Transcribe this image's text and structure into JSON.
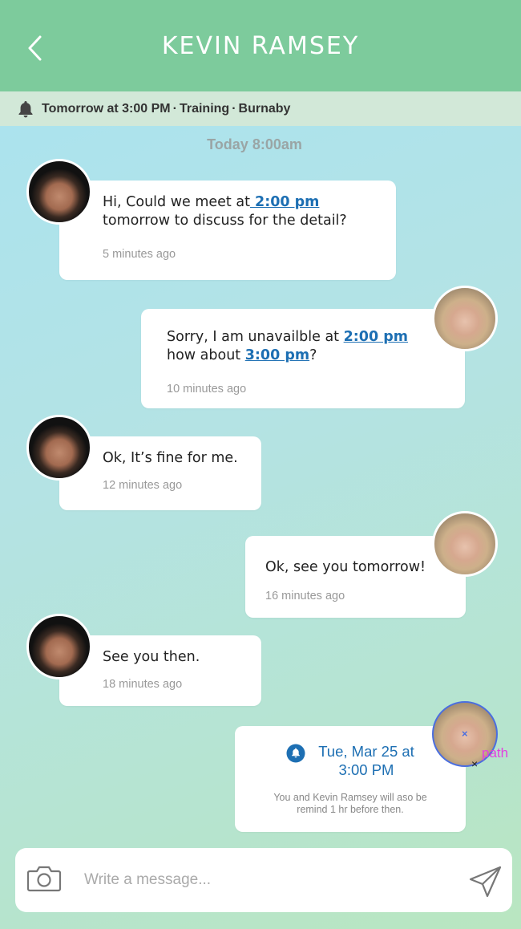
{
  "header": {
    "title": "KEVIN RAMSEY",
    "back_icon": "chevron-left-icon"
  },
  "reminder": {
    "icon": "bell-icon",
    "time": "Tomorrow at 3:00 PM",
    "separator": "·",
    "activity": "Training",
    "location": "Burnaby"
  },
  "divider": {
    "label": "Today 8:00am"
  },
  "messages": [
    {
      "sender": "Kevin Ramsey",
      "text_before": "Hi,  Could we meet at",
      "link": " 2:00 pm",
      "text_after": " tomorrow to discuss for the detail?",
      "time": "5 minutes ago"
    },
    {
      "sender": "me",
      "text_before": "Sorry, I am unavailble at ",
      "link": "2:00 pm",
      "text_mid": " how about ",
      "link2": "3:00 pm",
      "text_after": "?",
      "time": "10 minutes ago"
    },
    {
      "sender": "Kevin Ramsey",
      "text": "Ok, It’s fine for me.",
      "time": "12 minutes ago"
    },
    {
      "sender": "me",
      "text": "Ok, see you tomorrow!",
      "time": "16 minutes ago"
    },
    {
      "sender": "Kevin Ramsey",
      "text": "See you then.",
      "time": "18 minutes ago"
    }
  ],
  "event": {
    "icon": "bell-icon",
    "title_line1": "Tue, Mar 25 at",
    "title_line2": "3:00 PM",
    "note_line1": "You and Kevin Ramsey will aso be",
    "note_line2": "remind 1 hr before then."
  },
  "annotation": {
    "label": "path",
    "x_mark": "×",
    "blue_mark": "×"
  },
  "composer": {
    "placeholder": "Write a message...",
    "camera_icon": "camera-icon",
    "send_icon": "send-icon"
  },
  "colors": {
    "header": "#7dcb9c",
    "reminder_bar": "#d2e8d8",
    "link": "#1d6fb3",
    "annotation": "#e33fe0"
  }
}
